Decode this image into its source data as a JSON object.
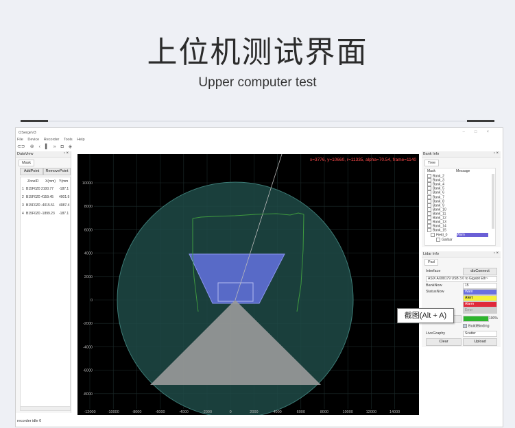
{
  "heading": {
    "title": "上位机测试界面",
    "subtitle": "Upper computer test"
  },
  "window": {
    "title": "OSergeV3",
    "menu": [
      "File",
      "Device",
      "Recorder",
      "Tools",
      "Help"
    ],
    "status": "recorder idle  0"
  },
  "dataview": {
    "title": "DataView",
    "tab": "Mask",
    "add_label": "AddPoint",
    "remove_label": "RemovePoint",
    "headers": [
      "ZoneID",
      "X(mm)",
      "Y(mm"
    ],
    "rows": [
      {
        "n": "1",
        "zone": "B15F0Z0",
        "x": "2100.77",
        "y": "-187.1"
      },
      {
        "n": "2",
        "zone": "B15F0Z0",
        "x": "4159.45",
        "y": "4001.9"
      },
      {
        "n": "3",
        "zone": "B15F0Z0",
        "x": "-4015.51",
        "y": "4087.4"
      },
      {
        "n": "4",
        "zone": "B15F0Z0",
        "x": "-1899.23",
        "y": "-187.1"
      }
    ]
  },
  "plot": {
    "readout": "x=3776, y=10660, r=11335, alpha=70.54, frame=1140",
    "x_ticks": [
      "-12000",
      "-10000",
      "-8000",
      "-6000",
      "-4000",
      "-2000",
      "0",
      "2000",
      "4000",
      "6000",
      "8000",
      "10000",
      "12000",
      "14000"
    ],
    "y_ticks": [
      "10000",
      "8000",
      "6000",
      "4000",
      "2000",
      "0",
      "-2000",
      "-4000",
      "-6000",
      "-8000"
    ]
  },
  "bankinfo": {
    "title": "Bank Info",
    "tab": "Tree",
    "headers": [
      "Mask",
      "Message"
    ],
    "items": [
      "Bank_2",
      "Bank_3",
      "Bank_4",
      "Bank_5",
      "Bank_6",
      "Bank_7",
      "Bank_8",
      "Bank_9",
      "Bank_10",
      "Bank_11",
      "Bank_12",
      "Bank_13",
      "Bank_14",
      "Bank_15"
    ],
    "field": "Field_0",
    "field_msg": "Warn",
    "sub": "Garbar"
  },
  "lidarinfo": {
    "title": "Lidar Info",
    "tab": "Pad",
    "interface_label": "Interface",
    "disconnect_label": "disConnect",
    "device": "ASIX AX88179 USB 3.0 to Gigabit Eth~",
    "banknow_label": "BankNow",
    "banknow_value": "15",
    "statusnow_label": "StatusNow",
    "status_warn": "Warn",
    "status_alert": "Alert",
    "status_alarm": "Alarm",
    "status_error": "Error",
    "download_label": "Download",
    "progress_label": "100%",
    "progress": 1.0,
    "buildbinding_label": "BuildBinding",
    "livegraphy_label": "LiveGraphy",
    "livegraphy_value": "Scatter",
    "clear_label": "Clear",
    "upload_label": "Upload"
  },
  "tooltip": "截图(Alt + A)"
}
